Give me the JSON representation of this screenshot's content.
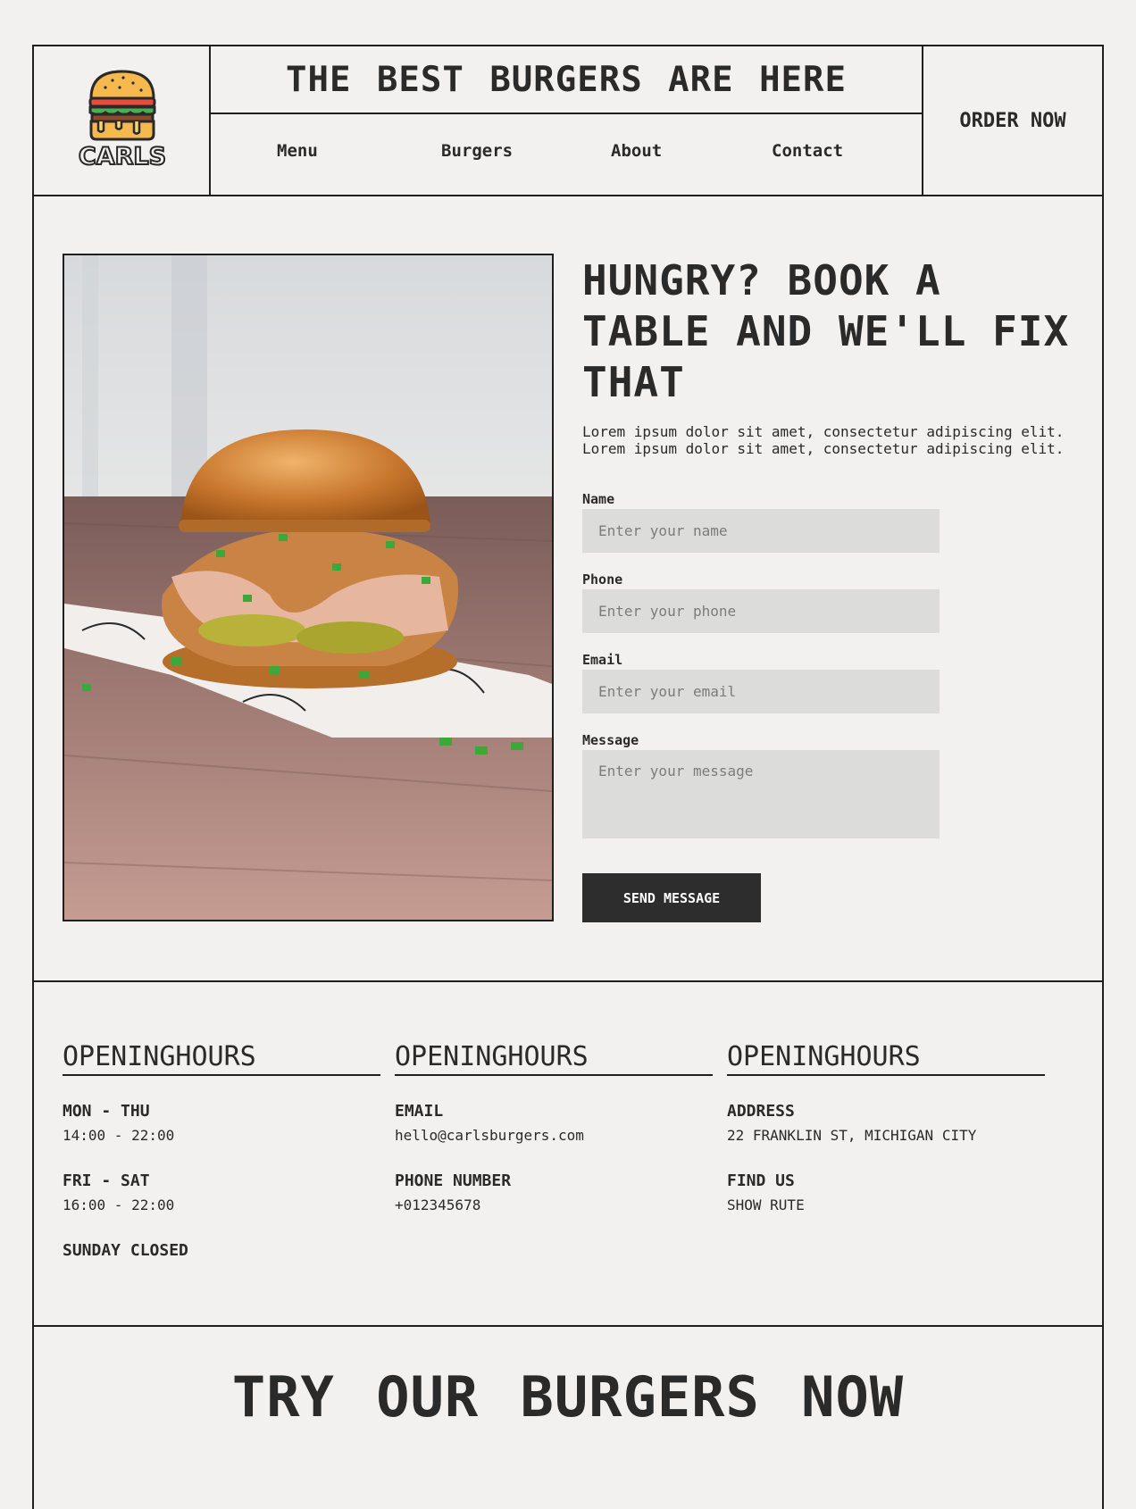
{
  "header": {
    "logo_text": "CARLS",
    "tagline": "THE BEST BURGERS ARE HERE",
    "nav": [
      "Menu",
      "Burgers",
      "About",
      "Contact"
    ],
    "order_label": "ORDER NOW"
  },
  "booking": {
    "title": "HUNGRY? BOOK A TABLE AND WE'LL FIX THAT",
    "text_line1": "Lorem ipsum dolor sit amet, consectetur adipiscing elit.",
    "text_line2": "Lorem ipsum dolor sit amet, consectetur adipiscing elit.",
    "form": {
      "name_label": "Name",
      "name_placeholder": "Enter your name",
      "phone_label": "Phone",
      "phone_placeholder": "Enter your phone",
      "email_label": "Email",
      "email_placeholder": "Enter your email",
      "message_label": "Message",
      "message_placeholder": "Enter your message",
      "send_label": "SEND MESSAGE"
    }
  },
  "info": {
    "col1": {
      "heading": "OPENINGHOURS",
      "t1": "MON - THU",
      "v1": "14:00 - 22:00",
      "t2": "FRI - SAT",
      "v2": "16:00 - 22:00",
      "t3": "SUNDAY CLOSED"
    },
    "col2": {
      "heading": "OPENINGHOURS",
      "t1": "EMAIL",
      "v1": "hello@carlsburgers.com",
      "t2": "PHONE NUMBER",
      "v2": "+012345678"
    },
    "col3": {
      "heading": "OPENINGHOURS",
      "t1": "ADDRESS",
      "v1": "22 FRANKLIN ST, MICHIGAN CITY",
      "t2": "FIND US",
      "v2": "SHOW RUTE"
    }
  },
  "cta": "TRY OUR BURGERS NOW",
  "colors": {
    "background": "#f3f1ef",
    "text": "#2a2a2a",
    "button": "#2d2d2d",
    "field": "#dcdcdb"
  },
  "icons": [
    "burger-logo-icon"
  ]
}
